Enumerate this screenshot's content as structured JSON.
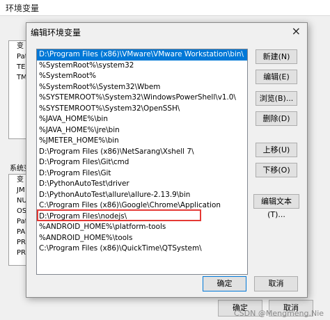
{
  "background_window": {
    "title": "环境变量",
    "user_rows": [
      "变",
      "Pat",
      "TEI",
      "TM"
    ],
    "system_label": "系统变",
    "system_rows": [
      "变",
      "JM",
      "NU",
      "OS",
      "Pat",
      "PA",
      "PR",
      "PR"
    ],
    "ok_label": "确定",
    "cancel_label": "取消"
  },
  "dialog": {
    "title": "编辑环境变量",
    "close_glyph": "×",
    "items": [
      "D:\\Program Files (x86)\\VMware\\VMware Workstation\\bin\\",
      "%SystemRoot%\\system32",
      "%SystemRoot%",
      "%SystemRoot%\\System32\\Wbem",
      "%SYSTEMROOT%\\System32\\WindowsPowerShell\\v1.0\\",
      "%SYSTEMROOT%\\System32\\OpenSSH\\",
      "%JAVA_HOME%\\bin",
      "%JAVA_HOME%\\jre\\bin",
      "%JMETER_HOME%\\bin",
      "D:\\Program Files (x86)\\NetSarang\\Xshell 7\\",
      "D:\\Program Files\\Git\\cmd",
      "D:\\Program Files\\Git",
      "D:\\PythonAutoTest\\driver",
      "D:\\PythonAutoTest\\allure\\allure-2.13.9\\bin",
      "C:\\Program Files (x86)\\Google\\Chrome\\Application",
      "D:\\Program Files\\nodejs\\",
      "%ANDROID_HOME%\\platform-tools",
      "%ANDROID_HOME%\\tools",
      "C:\\Program Files (x86)\\QuickTime\\QTSystem\\"
    ],
    "buttons": {
      "new": "新建(N)",
      "edit": "编辑(E)",
      "browse": "浏览(B)...",
      "delete": "删除(D)",
      "move_up": "上移(U)",
      "move_down": "下移(O)",
      "edit_text": "编辑文本(T)...",
      "ok": "确定",
      "cancel": "取消"
    }
  },
  "watermark": "CSDN @Mengmeng.Nie"
}
